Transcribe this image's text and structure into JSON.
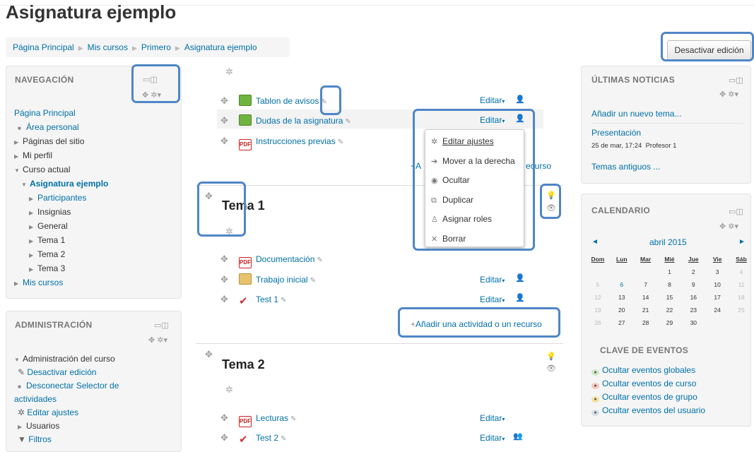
{
  "page_title": "Asignatura ejemplo",
  "breadcrumb": [
    "Página Principal",
    "Mis cursos",
    "Primero",
    "Asignatura ejemplo"
  ],
  "edit_toggle_label": "Desactivar edición",
  "navigation": {
    "title": "NAVEGACIÓN",
    "items": [
      "Página Principal",
      "Área personal",
      "Páginas del sitio",
      "Mi perfil",
      "Curso actual",
      "Asignatura ejemplo",
      "Participantes",
      "Insignias",
      "General",
      "Tema 1",
      "Tema 2",
      "Tema 3",
      "Mis cursos"
    ]
  },
  "administration": {
    "title": "ADMINISTRACIÓN",
    "items": [
      "Administración del curso",
      "Desactivar edición",
      "Desconectar Selector de",
      "actividades",
      "Editar ajustes",
      "Usuarios",
      "Filtros"
    ]
  },
  "general_section": {
    "activities": [
      {
        "name": "Tablon de avisos",
        "icon": "forum-icon",
        "edit": "Editar"
      },
      {
        "name": "Dudas de la asignatura",
        "icon": "forum-icon",
        "edit": "Editar"
      },
      {
        "name": "Instrucciones previas",
        "icon": "pdf-icon",
        "edit": ""
      }
    ],
    "add_activity_partial_left": "+A",
    "add_activity_partial_right": "ecurso"
  },
  "edit_menu": [
    "Editar ajustes",
    "Mover a la derecha",
    "Ocultar",
    "Duplicar",
    "Asignar roles",
    "Borrar"
  ],
  "tema1": {
    "title": "Tema 1",
    "activities": [
      {
        "name": "Documentación",
        "icon": "pdf-icon",
        "edit": "Editar"
      },
      {
        "name": "Trabajo inicial",
        "icon": "assignment-icon",
        "edit": "Editar"
      },
      {
        "name": "Test 1",
        "icon": "quiz-icon",
        "edit": "Editar"
      }
    ],
    "add_activity": "Añadir una actividad o un recurso"
  },
  "tema2": {
    "title": "Tema 2",
    "activities": [
      {
        "name": "Lecturas",
        "icon": "pdf-icon",
        "edit": "Editar"
      },
      {
        "name": "Test 2",
        "icon": "quiz-icon",
        "edit": "Editar"
      }
    ]
  },
  "news": {
    "title": "ÚLTIMAS NOTICIAS",
    "add_topic": "Añadir un nuevo tema...",
    "post_title": "Presentación",
    "post_meta": "25 de mar, 17:24  Profesor 1",
    "older": "Temas antiguos ..."
  },
  "calendar": {
    "title": "CALENDARIO",
    "month": "abril 2015",
    "prev": "◄",
    "next": "►",
    "weekdays": [
      "Dom",
      "Lun",
      "Mar",
      "Mié",
      "Jue",
      "Vie",
      "Sáb"
    ],
    "weeks": [
      [
        "",
        "",
        "",
        "1",
        "2",
        "3",
        "4"
      ],
      [
        "5",
        "6",
        "7",
        "8",
        "9",
        "10",
        "11"
      ],
      [
        "12",
        "13",
        "14",
        "15",
        "16",
        "17",
        "18"
      ],
      [
        "19",
        "20",
        "21",
        "22",
        "23",
        "24",
        "25"
      ],
      [
        "26",
        "27",
        "28",
        "29",
        "30",
        "",
        ""
      ]
    ],
    "events_key_title": "CLAVE DE EVENTOS",
    "events": [
      {
        "label": "Ocultar eventos globales",
        "color": "#cfe8c7"
      },
      {
        "label": "Ocultar eventos de curso",
        "color": "#f6c9bc"
      },
      {
        "label": "Ocultar eventos de grupo",
        "color": "#f5e3a0"
      },
      {
        "label": "Ocultar eventos del usuario",
        "color": "#d4dde8"
      }
    ]
  },
  "colors": {
    "link": "#0070a8",
    "highlight": "#4f86c6"
  }
}
